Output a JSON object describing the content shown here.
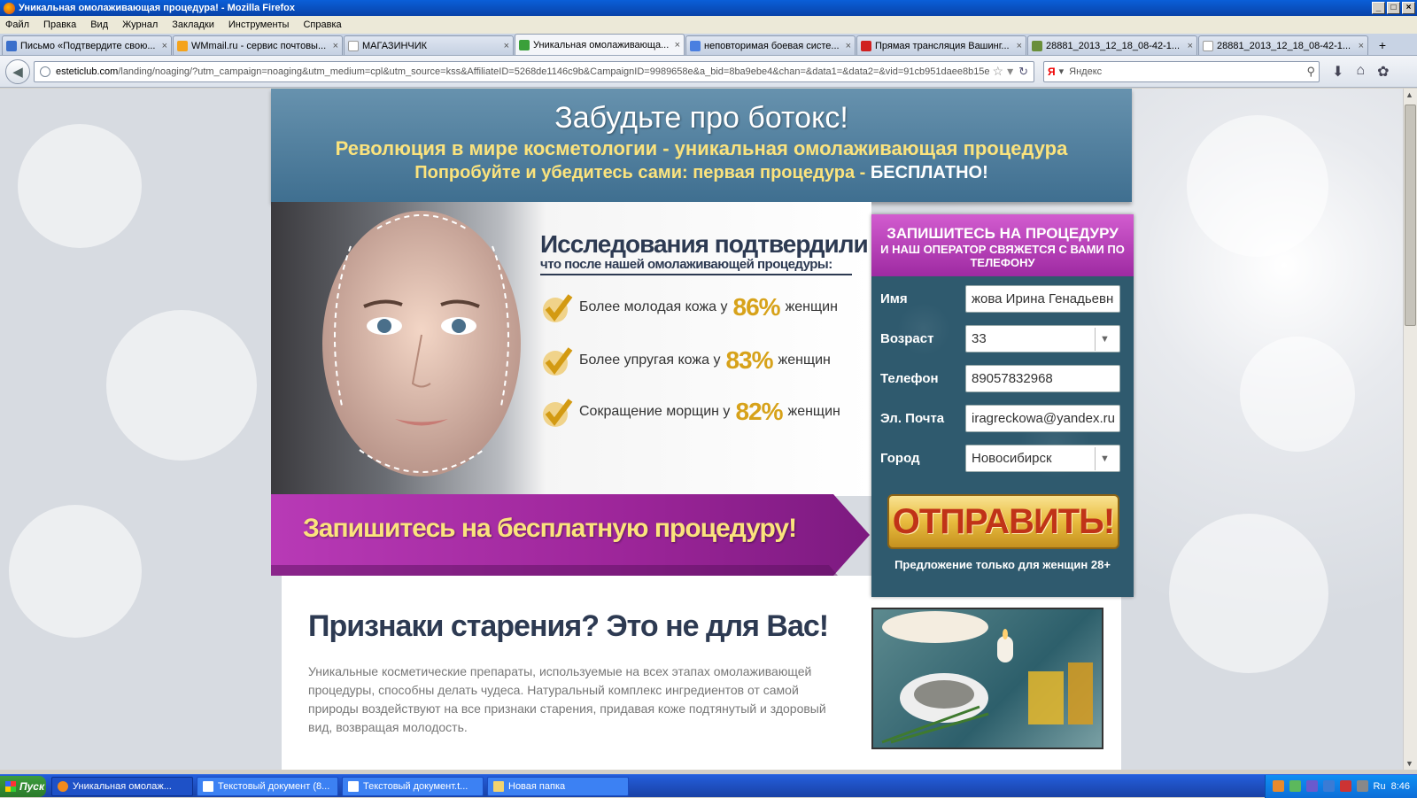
{
  "window": {
    "title": "Уникальная омолаживающая процедура! - Mozilla Firefox"
  },
  "menu": [
    "Файл",
    "Правка",
    "Вид",
    "Журнал",
    "Закладки",
    "Инструменты",
    "Справка"
  ],
  "tabs": [
    {
      "label": "Письмо «Подтвердите свою...",
      "icon_color": "#3a6fcb"
    },
    {
      "label": "WMmail.ru - сервис почтовы...",
      "icon_color": "#f4a31c"
    },
    {
      "label": "МАГАЗИНЧИК",
      "icon_color": "#999999"
    },
    {
      "label": "Уникальная омолаживающа...",
      "icon_color": "#3aa03a"
    },
    {
      "label": "неповторимая боевая систе...",
      "icon_color": "#4a7fe0"
    },
    {
      "label": "Прямая трансляция Вашинг...",
      "icon_color": "#d02020"
    },
    {
      "label": "28881_2013_12_18_08-42-1...",
      "icon_color": "#6a8f3a"
    },
    {
      "label": "28881_2013_12_18_08-42-1...",
      "icon_color": "#888888"
    }
  ],
  "url": {
    "domain": "esteticlub.com",
    "path": "/landing/noaging/?utm_campaign=noaging&utm_medium=cpl&utm_source=kss&AffiliateID=5268de1146c9b&CampaignID=9989658e&a_bid=8ba9ebe4&chan=&data1=&data2=&vid=91cb951daee8b15e"
  },
  "search": {
    "engine": "Я",
    "placeholder": "Яндекс"
  },
  "header": {
    "title": "Забудьте про ботокс!",
    "sub1": "Революция в мире косметологии - уникальная омолаживающая процедура",
    "sub2": "Попробуйте и убедитесь сами: первая процедура -",
    "sub2_bold": "БЕСПЛАТНО!"
  },
  "studies": {
    "title": "Исследования подтвердили",
    "subtitle": "что после нашей омолаживающей процедуры:",
    "items": [
      {
        "pre": "Более молодая кожа у",
        "pct": "86%",
        "post": "женщин"
      },
      {
        "pre": "Более упругая кожа у",
        "pct": "83%",
        "post": "женщин"
      },
      {
        "pre": "Сокращение морщин у",
        "pct": "82%",
        "post": "женщин"
      }
    ]
  },
  "ribbon": {
    "text": "Запишитесь на бесплатную процедуру!"
  },
  "form": {
    "title": "ЗАПИШИТЕСЬ НА ПРОЦЕДУРУ",
    "subtitle": "И НАШ ОПЕРАТОР СВЯЖЕТСЯ С ВАМИ ПО ТЕЛЕФОНУ",
    "fields": [
      {
        "label": "Имя",
        "value": "жова Ирина Генадьевна"
      },
      {
        "label": "Возраст",
        "value": "33"
      },
      {
        "label": "Телефон",
        "value": "89057832968"
      },
      {
        "label": "Эл. Почта",
        "value": "iragreckowa@yandex.ru"
      },
      {
        "label": "Город",
        "value": "Новосибирск"
      }
    ],
    "submit": "ОТПРАВИТЬ!",
    "note": "Предложение только для женщин 28+"
  },
  "lower": {
    "title": "Признаки старения? Это не для Вас!",
    "text": "Уникальные косметические препараты, используемые на всех этапах омолаживающей процедуры, способны делать чудеса. Натуральный комплекс ингредиентов от самой природы воздействуют на все признаки старения, придавая коже подтянутый и здоровый вид, возвращая молодость."
  },
  "taskbar": {
    "start": "Пуск",
    "items": [
      {
        "label": "Уникальная омолаж..."
      },
      {
        "label": "Текстовый документ (8..."
      },
      {
        "label": "Текстовый документ.t..."
      },
      {
        "label": "Новая папка"
      }
    ],
    "lang": "Ru",
    "time": "8:46"
  },
  "colors": {
    "accent": "#9e2aa2",
    "header": "#4f7f9e",
    "gold": "#d7a21a",
    "form_bg": "#2f5a6e"
  }
}
